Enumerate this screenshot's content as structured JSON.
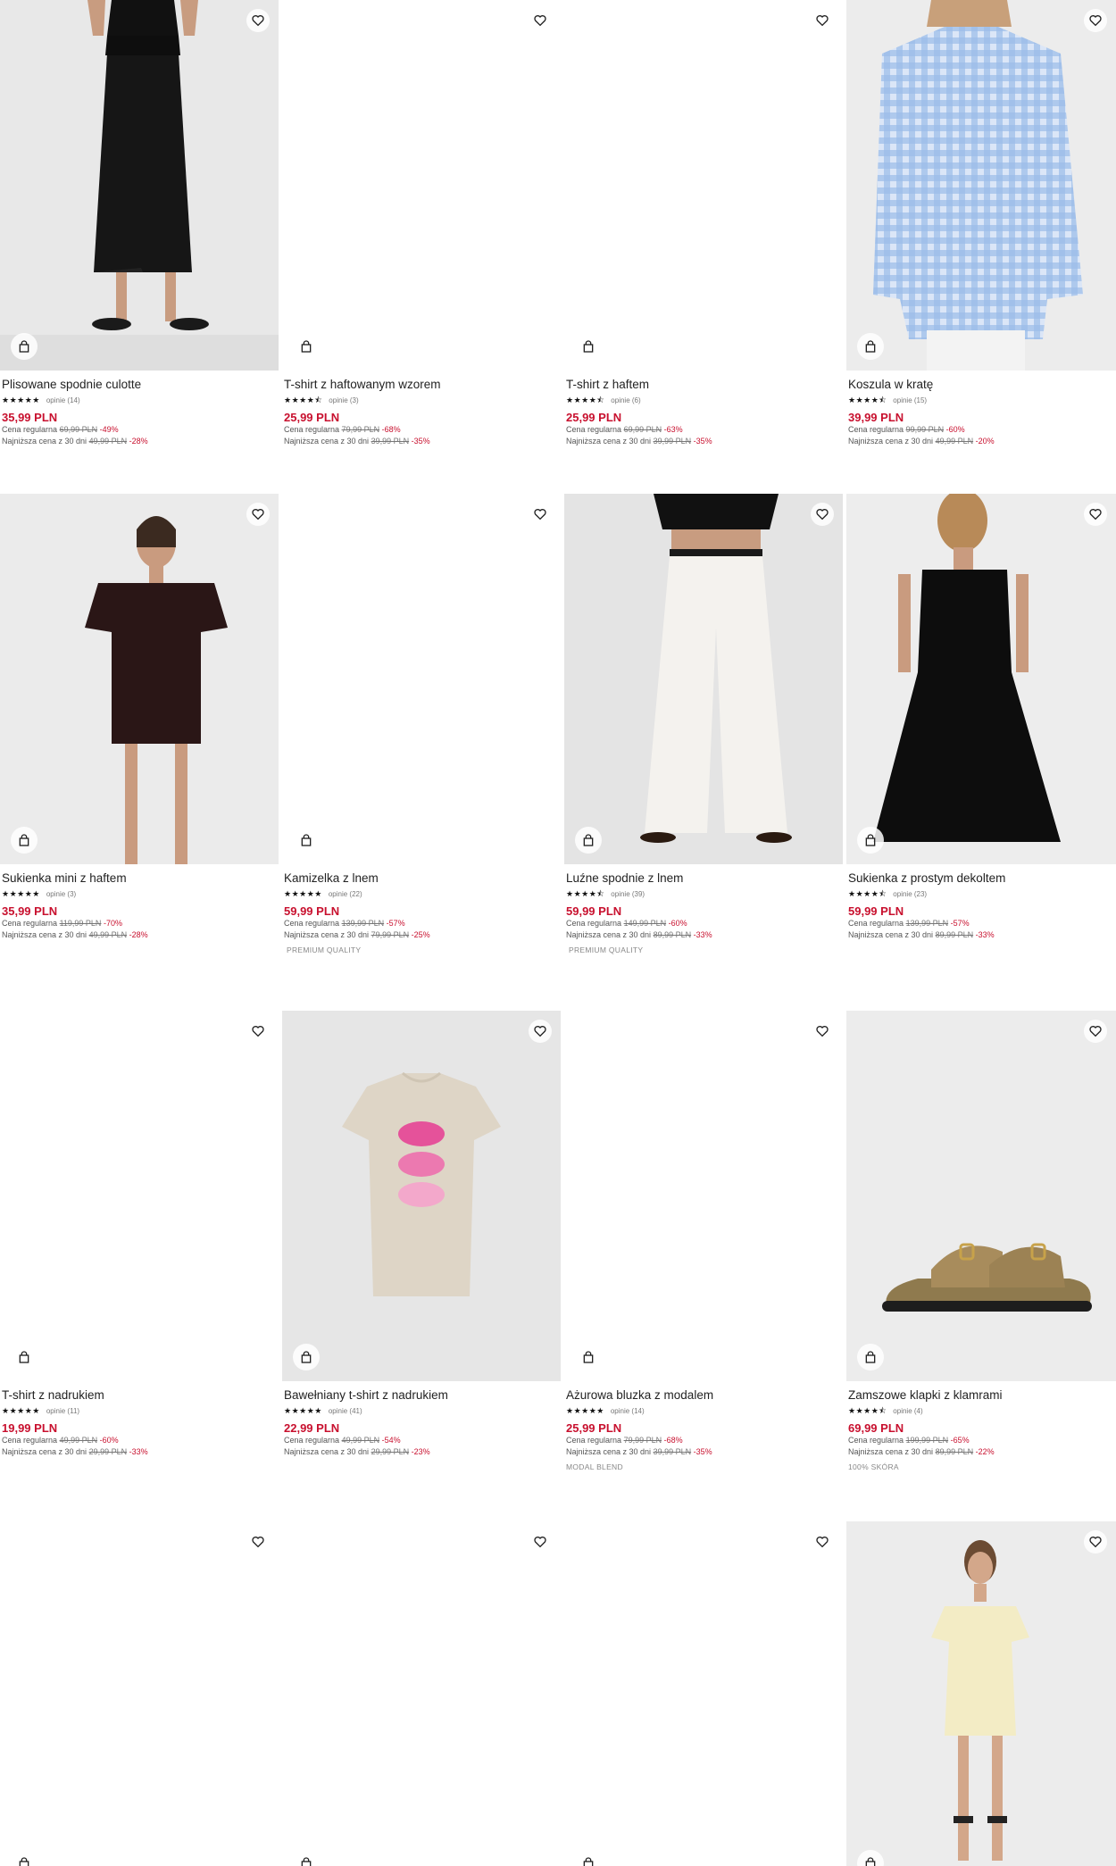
{
  "labels": {
    "regular": "Cena regularna",
    "lowest": "Najniższa cena z 30 dni"
  },
  "products": [
    {
      "name": "Plisowane spodnie culotte",
      "reviews": "opinie (14)",
      "stars": "★★★★★",
      "price": "35,99 PLN",
      "regular": "69,99 PLN",
      "regular_disc": "-49%",
      "lowest": "49,99 PLN",
      "lowest_disc": "-28%",
      "tag": ""
    },
    {
      "name": "T-shirt z haftowanym wzorem",
      "reviews": "opinie (3)",
      "stars": "★★★★⯪",
      "price": "25,99 PLN",
      "regular": "79,99 PLN",
      "regular_disc": "-68%",
      "lowest": "39,99 PLN",
      "lowest_disc": "-35%",
      "tag": ""
    },
    {
      "name": "T-shirt z haftem",
      "reviews": "opinie (6)",
      "stars": "★★★★⯪",
      "price": "25,99 PLN",
      "regular": "69,99 PLN",
      "regular_disc": "-63%",
      "lowest": "39,99 PLN",
      "lowest_disc": "-35%",
      "tag": ""
    },
    {
      "name": "Koszula w kratę",
      "reviews": "opinie (15)",
      "stars": "★★★★⯪",
      "price": "39,99 PLN",
      "regular": "99,99 PLN",
      "regular_disc": "-60%",
      "lowest": "49,99 PLN",
      "lowest_disc": "-20%",
      "tag": ""
    },
    {
      "name": "Sukienka mini z haftem",
      "reviews": "opinie (3)",
      "stars": "★★★★★",
      "price": "35,99 PLN",
      "regular": "119,99 PLN",
      "regular_disc": "-70%",
      "lowest": "49,99 PLN",
      "lowest_disc": "-28%",
      "tag": ""
    },
    {
      "name": "Kamizelka z lnem",
      "reviews": "opinie (22)",
      "stars": "★★★★★",
      "price": "59,99 PLN",
      "regular": "139,99 PLN",
      "regular_disc": "-57%",
      "lowest": "79,99 PLN",
      "lowest_disc": "-25%",
      "tag": "PREMIUM QUALITY"
    },
    {
      "name": "Luźne spodnie z lnem",
      "reviews": "opinie (39)",
      "stars": "★★★★⯪",
      "price": "59,99 PLN",
      "regular": "149,99 PLN",
      "regular_disc": "-60%",
      "lowest": "89,99 PLN",
      "lowest_disc": "-33%",
      "tag": "PREMIUM QUALITY"
    },
    {
      "name": "Sukienka z prostym dekoltem",
      "reviews": "opinie (23)",
      "stars": "★★★★⯪",
      "price": "59,99 PLN",
      "regular": "139,99 PLN",
      "regular_disc": "-57%",
      "lowest": "89,99 PLN",
      "lowest_disc": "-33%",
      "tag": ""
    },
    {
      "name": "T-shirt z nadrukiem",
      "reviews": "opinie (11)",
      "stars": "★★★★★",
      "price": "19,99 PLN",
      "regular": "49,99 PLN",
      "regular_disc": "-60%",
      "lowest": "29,99 PLN",
      "lowest_disc": "-33%",
      "tag": ""
    },
    {
      "name": "Bawełniany t-shirt z nadrukiem",
      "reviews": "opinie (41)",
      "stars": "★★★★★",
      "price": "22,99 PLN",
      "regular": "49,99 PLN",
      "regular_disc": "-54%",
      "lowest": "29,99 PLN",
      "lowest_disc": "-23%",
      "tag": ""
    },
    {
      "name": "Ażurowa bluzka z modalem",
      "reviews": "opinie (14)",
      "stars": "★★★★★",
      "price": "25,99 PLN",
      "regular": "79,99 PLN",
      "regular_disc": "-68%",
      "lowest": "39,99 PLN",
      "lowest_disc": "-35%",
      "tag": "MODAL BLEND"
    },
    {
      "name": "Zamszowe klapki z klamrami",
      "reviews": "opinie (4)",
      "stars": "★★★★⯪",
      "price": "69,99 PLN",
      "regular": "199,99 PLN",
      "regular_disc": "-65%",
      "lowest": "89,99 PLN",
      "lowest_disc": "-22%",
      "tag": "100% SKÓRA"
    }
  ]
}
